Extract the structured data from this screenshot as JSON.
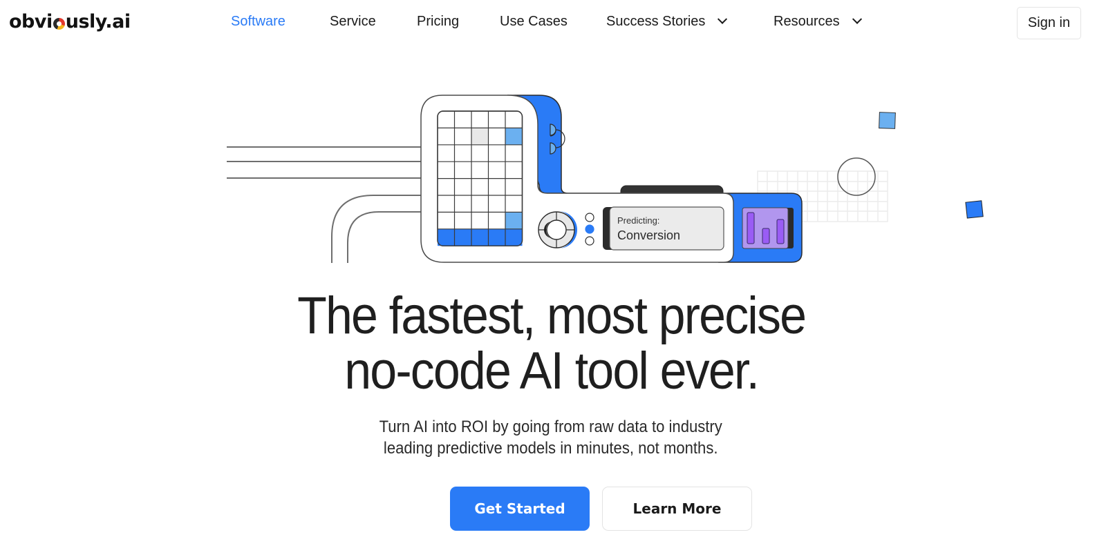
{
  "brand": {
    "logo_text_left": "obvi",
    "logo_text_right": "usly.ai",
    "accent_color": "#2a7bf6"
  },
  "nav": {
    "items": [
      {
        "label": "Software",
        "active": true,
        "has_dropdown": false
      },
      {
        "label": "Service",
        "active": false,
        "has_dropdown": false
      },
      {
        "label": "Pricing",
        "active": false,
        "has_dropdown": false
      },
      {
        "label": "Use Cases",
        "active": false,
        "has_dropdown": false
      },
      {
        "label": "Success Stories",
        "active": false,
        "has_dropdown": true
      },
      {
        "label": "Resources",
        "active": false,
        "has_dropdown": true
      }
    ],
    "signin_label": "Sign in"
  },
  "illustration": {
    "predicting_label": "Predicting:",
    "predicting_value": "Conversion",
    "colors": {
      "blue": "#2a7bf6",
      "light_blue": "#6bb0f0",
      "purple_panel": "#b196ee",
      "purple_bar": "#9a5cf5",
      "dark": "#2b2b2b",
      "grey_cell": "#e8e8e8"
    }
  },
  "hero": {
    "headline_line1": "The fastest, most precise",
    "headline_line2": "no-code AI tool ever.",
    "subheadline_line1": "Turn AI into ROI by going from raw data to industry",
    "subheadline_line2": "leading predictive models in minutes, not months.",
    "primary_cta": "Get Started",
    "secondary_cta": "Learn More"
  }
}
